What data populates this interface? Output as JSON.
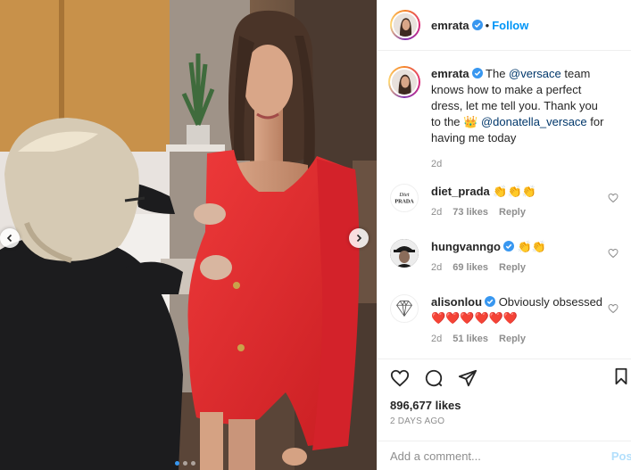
{
  "header": {
    "username": "emrata",
    "separator": "•",
    "follow_label": "Follow"
  },
  "caption": {
    "username": "emrata",
    "text_1": "The ",
    "mention_1": "@versace",
    "text_2": " team knows how to make a perfect dress, let me tell you. Thank you to the ",
    "emoji": "👑",
    "mention_2": "@donatella_versace",
    "text_3": " for having me today",
    "age": "2d"
  },
  "comments": [
    {
      "username": "diet_prada",
      "verified": false,
      "text": "👏👏👏",
      "age": "2d",
      "likes": "73 likes",
      "reply_label": "Reply",
      "avatar": "diet-prada-logo"
    },
    {
      "username": "hungvanngo",
      "verified": true,
      "text": "👏👏",
      "age": "2d",
      "likes": "69 likes",
      "reply_label": "Reply",
      "avatar": "hat-man"
    },
    {
      "username": "alisonlou",
      "verified": true,
      "text": "Obviously obsessed ❤️❤️❤️❤️❤️❤️",
      "age": "2d",
      "likes": "51 likes",
      "reply_label": "Reply",
      "avatar": "diamond-logo"
    }
  ],
  "actions": {
    "likes": "896,677 likes",
    "date": "2 DAYS AGO"
  },
  "add_comment": {
    "placeholder": "Add a comment...",
    "post_label": "Post"
  },
  "carousel": {
    "slide_count": 3,
    "active_slide": 1
  },
  "colors": {
    "accent": "#0095f6",
    "dress": "#e3262b",
    "verified": "#3897f0"
  }
}
